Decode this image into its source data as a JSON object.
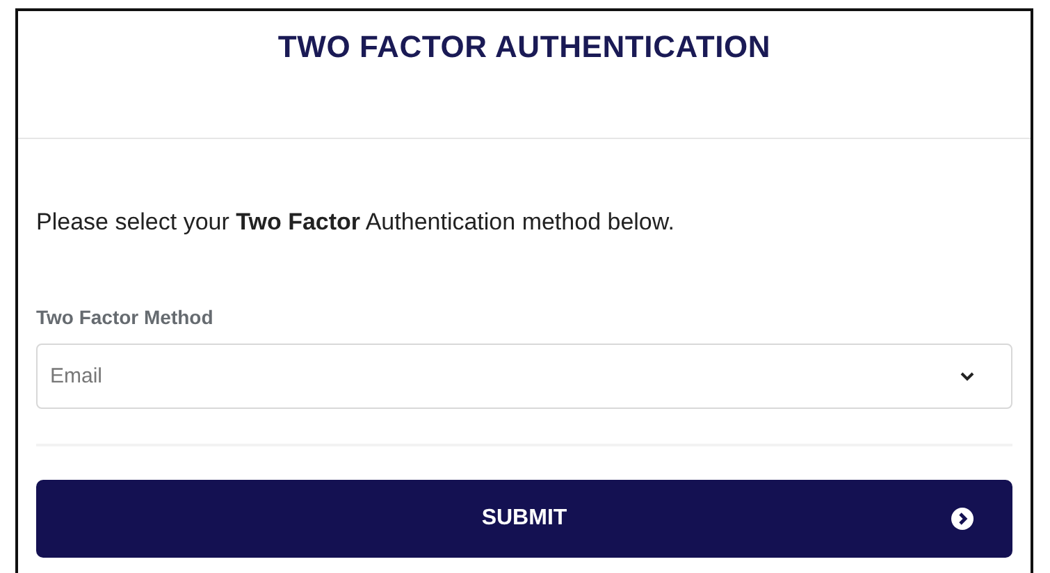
{
  "header": {
    "title": "TWO FACTOR AUTHENTICATION"
  },
  "instructions": "Please select your **Two Factor** Authentication method below.",
  "method_field": {
    "label": "Two Factor Method",
    "value": "Email"
  },
  "submit_button": {
    "label": "SUBMIT"
  }
}
